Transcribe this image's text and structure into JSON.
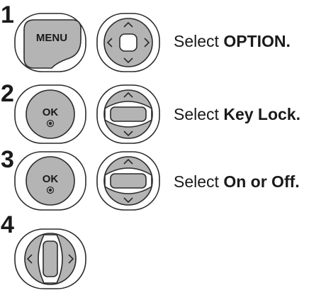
{
  "steps": [
    {
      "number": "1",
      "buttons": [
        {
          "name": "menu-button",
          "label": "MENU",
          "icon": "menu-key-icon"
        },
        {
          "name": "navigation-pad-button",
          "icon": "four-way-nav-icon"
        }
      ],
      "text_prefix": "Select ",
      "text_bold": "OPTION."
    },
    {
      "number": "2",
      "buttons": [
        {
          "name": "ok-button",
          "label": "OK",
          "icon": "ok-key-icon"
        },
        {
          "name": "up-down-navigation-button",
          "icon": "up-down-nav-icon"
        }
      ],
      "text_prefix": "Select ",
      "text_bold": "Key Lock."
    },
    {
      "number": "3",
      "buttons": [
        {
          "name": "ok-button",
          "label": "OK",
          "icon": "ok-key-icon"
        },
        {
          "name": "up-down-navigation-button",
          "icon": "up-down-nav-icon"
        }
      ],
      "text_prefix": "Select ",
      "text_bold": "On or Off."
    },
    {
      "number": "4",
      "buttons": [
        {
          "name": "left-right-navigation-button",
          "icon": "left-right-nav-icon"
        }
      ]
    }
  ],
  "colors": {
    "button_fill": "#b4b4b4",
    "button_outline": "#2a2a2a",
    "text": "#1a1a1a"
  }
}
